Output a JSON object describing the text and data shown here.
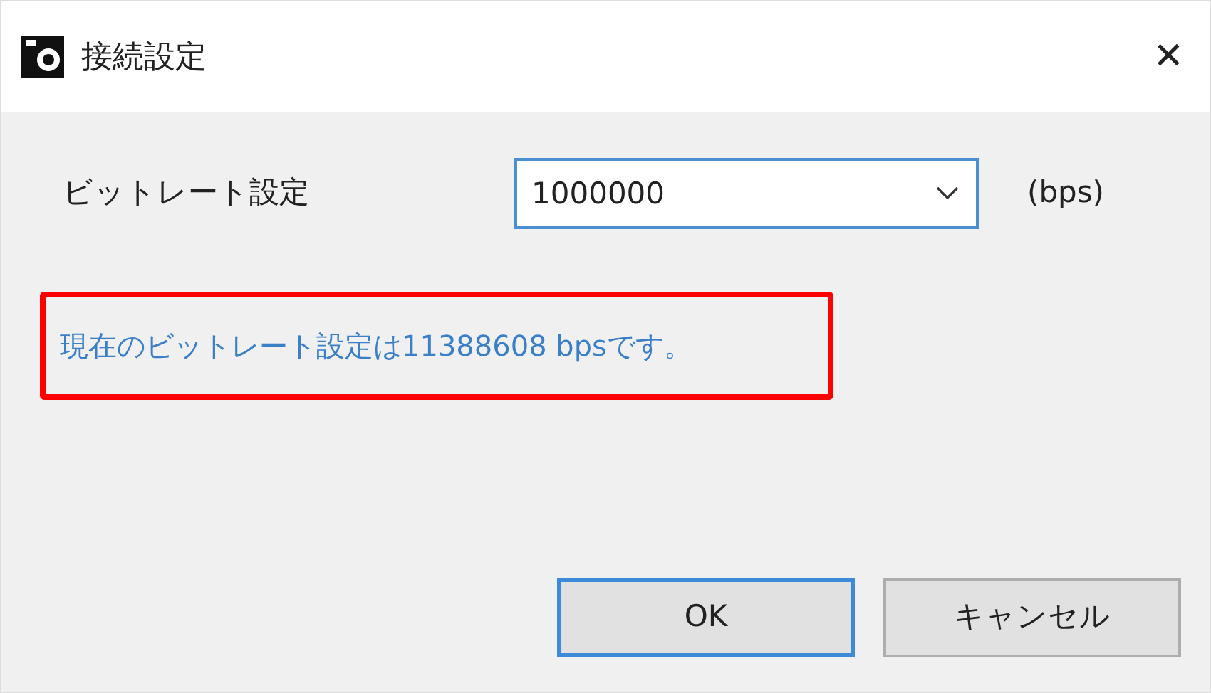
{
  "window": {
    "title": "接続設定",
    "close": "✕"
  },
  "bitrate": {
    "label": "ビットレート設定",
    "value": "1000000",
    "unit": "(bps)"
  },
  "message": {
    "text": "現在のビットレート設定は11388608 bpsです。",
    "highlighted": true
  },
  "buttons": [
    {
      "label": "OK",
      "default": true
    },
    {
      "label": "キャンセル",
      "default": false
    }
  ]
}
